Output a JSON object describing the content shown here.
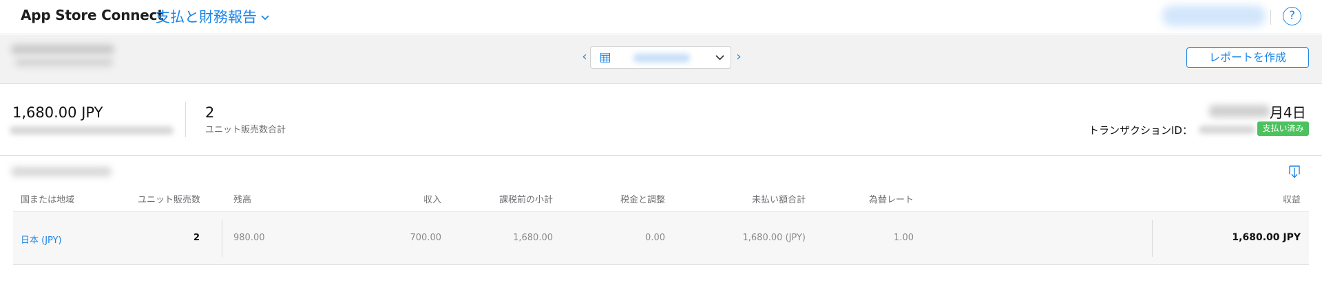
{
  "header": {
    "app_title": "App Store Connect",
    "section_title": "支払と財務報告",
    "help_label": "?"
  },
  "filterbar": {
    "prev_label": "‹",
    "next_label": "›",
    "create_report_label": "レポートを作成"
  },
  "summary": {
    "total_amount": "1,680.00 JPY",
    "units_value": "2",
    "units_label": "ユニット販売数合計",
    "date_day": "月4日",
    "transaction_label": "トランザクションID：",
    "status_badge": "支払い済み"
  },
  "table": {
    "columns": [
      "国または地域",
      "ユニット販売数",
      "残高",
      "収入",
      "課税前の小計",
      "税金と調整",
      "未払い額合計",
      "為替レート",
      "収益"
    ],
    "rows": [
      {
        "country": "日本 (JPY)",
        "units": "2",
        "balance": "980.00",
        "income": "700.00",
        "subtotal": "1,680.00",
        "tax": "0.00",
        "total_unpaid": "1,680.00 (JPY)",
        "exchange_rate": "1.00",
        "earnings": "1,680.00 JPY"
      }
    ]
  },
  "colors": {
    "accent": "#1a85e8",
    "paid": "#4cc25e"
  }
}
